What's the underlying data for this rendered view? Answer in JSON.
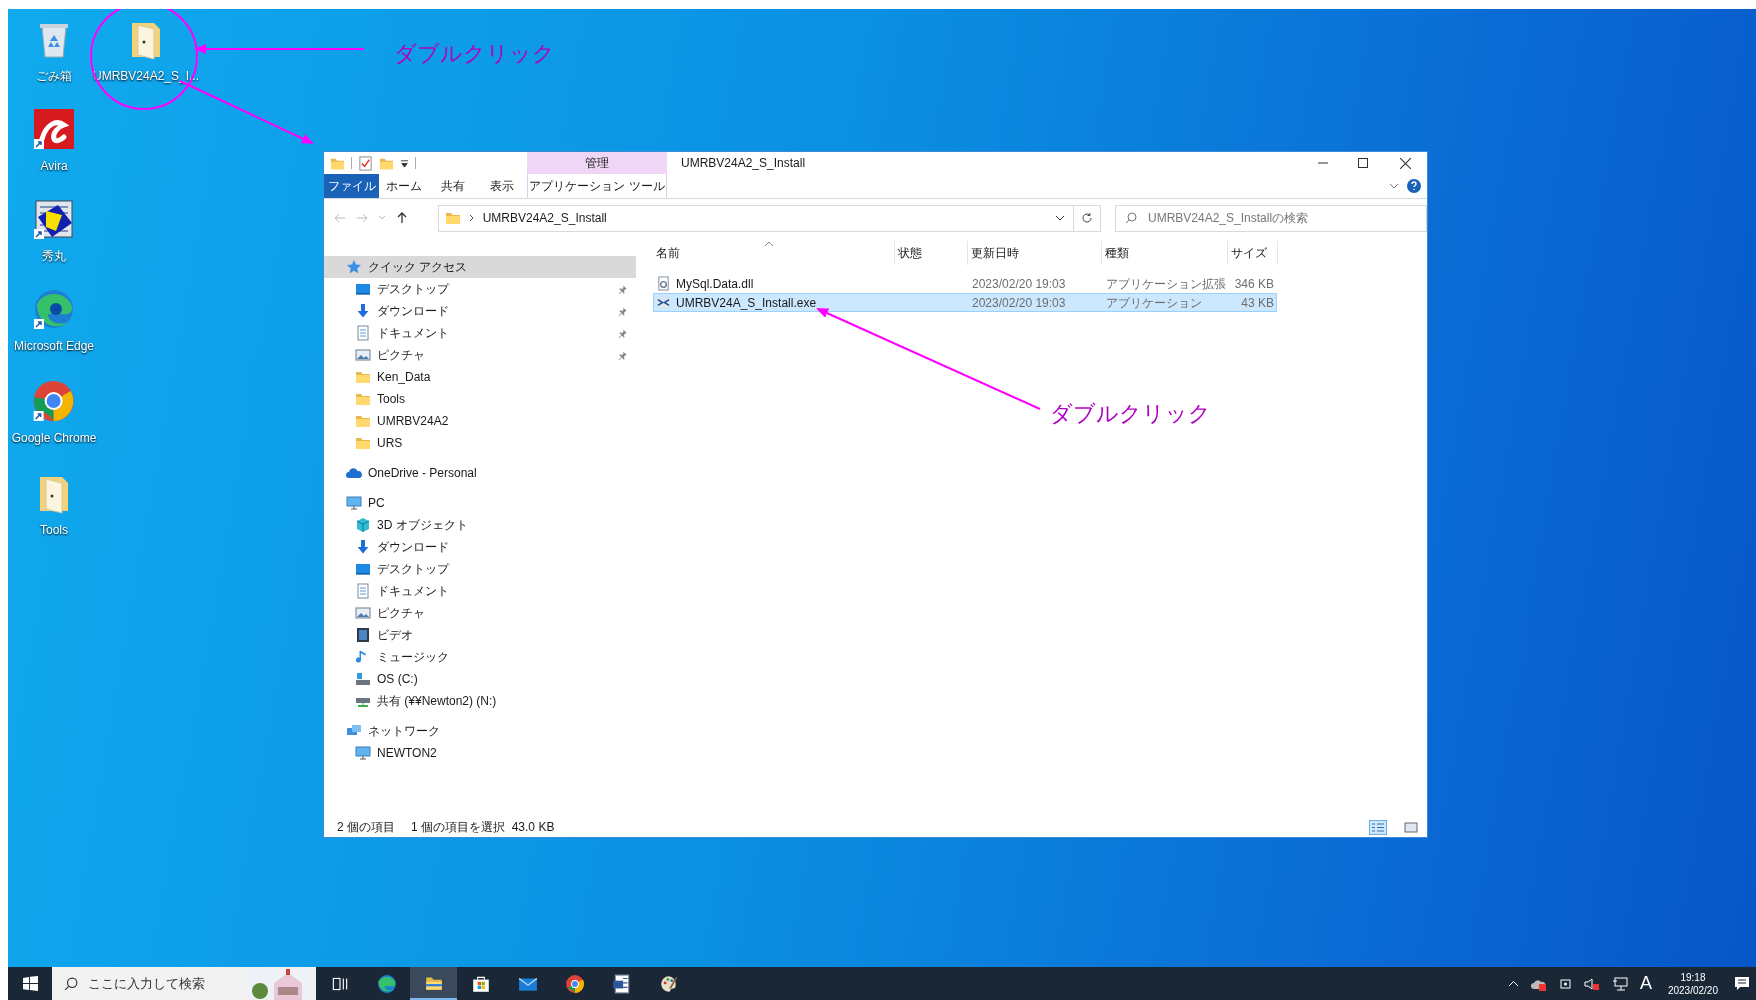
{
  "desktop": {
    "icons": [
      {
        "label": "ごみ箱",
        "kind": "recycle"
      },
      {
        "label": "UMRBV24A2_S_I...",
        "kind": "folder"
      },
      {
        "label": "Avira",
        "kind": "avira"
      },
      {
        "label": "秀丸",
        "kind": "hidemaru"
      },
      {
        "label": "Microsoft Edge",
        "kind": "edge"
      },
      {
        "label": "Google Chrome",
        "kind": "chrome"
      },
      {
        "label": "Tools",
        "kind": "folder"
      }
    ]
  },
  "annotations": [
    {
      "text": "ダブルクリック"
    },
    {
      "text": "ダブルクリック"
    }
  ],
  "explorer": {
    "title": "UMRBV24A2_S_Install",
    "context_header": "管理",
    "ribbon_tabs": [
      {
        "label": "ファイル",
        "kind": "file"
      },
      {
        "label": "ホーム",
        "kind": "tab"
      },
      {
        "label": "共有",
        "kind": "tab"
      },
      {
        "label": "表示",
        "kind": "tab"
      },
      {
        "label": "アプリケーション ツール",
        "kind": "context"
      }
    ],
    "address": {
      "path": "UMRBV24A2_S_Install"
    },
    "search": {
      "placeholder": "UMRBV24A2_S_Installの検索"
    },
    "nav": [
      {
        "label": "クイック アクセス",
        "kind": "star",
        "selected": true,
        "children": [
          {
            "label": "デスクトップ",
            "kind": "desktop",
            "pinned": true,
            "selected": false
          },
          {
            "label": "ダウンロード",
            "kind": "download",
            "pinned": true,
            "selected": false
          },
          {
            "label": "ドキュメント",
            "kind": "document",
            "pinned": true,
            "selected": false
          },
          {
            "label": "ピクチャ",
            "kind": "picture",
            "pinned": true,
            "selected": false
          },
          {
            "label": "Ken_Data",
            "kind": "folder",
            "pinned": false,
            "selected": false
          },
          {
            "label": "Tools",
            "kind": "folder",
            "pinned": false,
            "selected": false
          },
          {
            "label": "UMRBV24A2",
            "kind": "folder",
            "pinned": false,
            "selected": false
          },
          {
            "label": "URS",
            "kind": "folder",
            "pinned": false,
            "selected": false
          }
        ]
      },
      {
        "label": "OneDrive - Personal",
        "kind": "cloud",
        "selected": false
      },
      {
        "label": "PC",
        "kind": "pc",
        "selected": false,
        "children": [
          {
            "label": "3D オブジェクト",
            "kind": "cube",
            "pinned": false,
            "selected": false
          },
          {
            "label": "ダウンロード",
            "kind": "download",
            "pinned": false,
            "selected": false
          },
          {
            "label": "デスクトップ",
            "kind": "desktop",
            "pinned": false,
            "selected": false
          },
          {
            "label": "ドキュメント",
            "kind": "document",
            "pinned": false,
            "selected": false
          },
          {
            "label": "ピクチャ",
            "kind": "picture",
            "pinned": false,
            "selected": false
          },
          {
            "label": "ビデオ",
            "kind": "video",
            "pinned": false,
            "selected": false
          },
          {
            "label": "ミュージック",
            "kind": "music",
            "pinned": false,
            "selected": false
          },
          {
            "label": "OS (C:)",
            "kind": "drive",
            "pinned": false,
            "selected": false
          },
          {
            "label": "共有 (¥¥Newton2) (N:)",
            "kind": "netdrive",
            "pinned": false,
            "selected": false
          }
        ]
      },
      {
        "label": "ネットワーク",
        "kind": "network",
        "selected": false,
        "children": [
          {
            "label": "NEWTON2",
            "kind": "pc",
            "pinned": false,
            "selected": false
          }
        ]
      }
    ],
    "columns": [
      "名前",
      "状態",
      "更新日時",
      "種類",
      "サイズ"
    ],
    "files": [
      {
        "name": "MySql.Data.dll",
        "kind": "dll",
        "modified": "2023/02/20 19:03",
        "type": "アプリケーション拡張",
        "size": "346 KB",
        "selected": false
      },
      {
        "name": "UMRBV24A_S_Install.exe",
        "kind": "exe",
        "modified": "2023/02/20 19:03",
        "type": "アプリケーション",
        "size": "43 KB",
        "selected": true
      }
    ],
    "status_bar": {
      "item_count": "2 個の項目",
      "selection": "1 個の項目を選択  43.0 KB"
    }
  },
  "taskbar": {
    "search_placeholder": "ここに入力して検索",
    "apps": [
      {
        "kind": "taskview",
        "active": false
      },
      {
        "kind": "edge",
        "active": false
      },
      {
        "kind": "explorer",
        "active": true
      },
      {
        "kind": "store",
        "active": false
      },
      {
        "kind": "mail",
        "active": false
      },
      {
        "kind": "chrome",
        "active": false
      },
      {
        "kind": "word",
        "active": false
      },
      {
        "kind": "paint",
        "active": false
      }
    ],
    "ime": "A",
    "time": "19:18",
    "date": "2023/02/20"
  }
}
